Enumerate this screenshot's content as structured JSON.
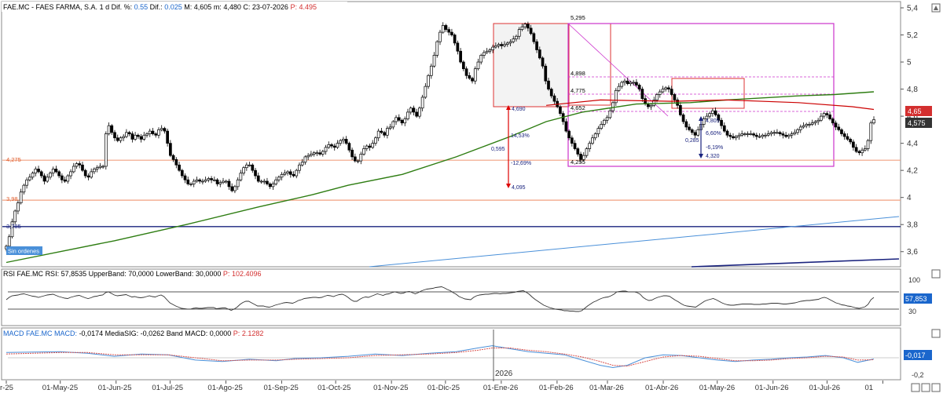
{
  "header": {
    "ticker": "FAE.MC",
    "company": "FAES FARMA, S.A.",
    "period": "1 d",
    "dif_pct_label": "Dif. %:",
    "dif_pct": "0.55",
    "dif_label": "Dif.:",
    "dif": "0.025",
    "max_label": "M:",
    "max": "4,605",
    "min_label": "m:",
    "min": "4,480",
    "cierre_label": "C:",
    "date": "23-07-2026",
    "price_label": "P:",
    "price": "4.495"
  },
  "rsi_header": {
    "name": "RSI",
    "ticker": "FAE.MC",
    "rsi_label": "RSI:",
    "rsi": "57,8535",
    "upper_label": "UpperBand:",
    "upper": "70,0000",
    "lower_label": "LowerBand:",
    "lower": "30,0000",
    "p_label": "P:",
    "p": "102.4096"
  },
  "macd_header": {
    "name": "MACD",
    "ticker": "FAE.MC",
    "macd_label": "MACD:",
    "macd": "-0,0174",
    "signal_label": "MediaSIG:",
    "signal": "-0,0262",
    "band_label": "Band MACD:",
    "band": "0,0000",
    "p_label": "P:",
    "p": "2.1282"
  },
  "order_badge": "Sin ordenes",
  "year_marker": "2026",
  "colors": {
    "up": "#ffffff",
    "down": "#000000",
    "sma_long": "#2e7d12",
    "sma_short": "#cc0000",
    "horiz_orange": "#f0a080",
    "horiz_blue": "#1a237e",
    "trend_blue": "#4a90d9",
    "magenta": "#cc33cc",
    "box_fill": "#f3f3f3",
    "price_badge": "#d32f2f",
    "last_badge": "#333333",
    "macd_line": "#4a90d9",
    "macd_signal": "#d9534f"
  },
  "chart_data": [
    {
      "type": "candlestick",
      "title": "",
      "x_ticks": [
        "r-25",
        "01-May-25",
        "01-Jun-25",
        "01-Jul-25",
        "01-Ago-25",
        "01-Sep-25",
        "01-Oct-25",
        "01-Nov-25",
        "01-Dic-25",
        "01-Ene-26",
        "01-Feb-26",
        "01-Mar-26",
        "01-Abr-26",
        "01-May-26",
        "01-Jun-26",
        "01-Jul-26",
        "01"
      ],
      "y_ticks": [
        "5,4",
        "5,2",
        "5",
        "4,8",
        "4,6",
        "4,4",
        "4,2",
        "4",
        "3,8",
        "3,6"
      ],
      "ylim": [
        3.5,
        5.4
      ],
      "xlim_days": [
        0,
        482
      ],
      "x_tick_days": [
        0,
        30,
        61,
        91,
        122,
        153,
        183,
        214,
        244,
        275,
        306,
        334,
        365,
        395,
        426,
        456,
        487
      ],
      "close": [
        3.64,
        3.71,
        3.82,
        3.9,
        3.96,
        4.04,
        4.09,
        4.13,
        4.15,
        4.18,
        4.21,
        4.19,
        4.16,
        4.12,
        4.15,
        4.18,
        4.21,
        4.19,
        4.16,
        4.13,
        4.12,
        4.16,
        4.19,
        4.23,
        4.25,
        4.24,
        4.2,
        4.16,
        4.15,
        4.19,
        4.21,
        4.22,
        4.23,
        4.23,
        4.47,
        4.53,
        4.48,
        4.44,
        4.42,
        4.44,
        4.45,
        4.48,
        4.47,
        4.43,
        4.46,
        4.45,
        4.43,
        4.46,
        4.47,
        4.49,
        4.47,
        4.46,
        4.5,
        4.51,
        4.49,
        4.4,
        4.31,
        4.28,
        4.24,
        4.2,
        4.16,
        4.13,
        4.1,
        4.1,
        4.12,
        4.13,
        4.12,
        4.12,
        4.13,
        4.14,
        4.13,
        4.13,
        4.1,
        4.11,
        4.12,
        4.12,
        4.08,
        4.05,
        4.08,
        4.13,
        4.18,
        4.22,
        4.24,
        4.24,
        4.2,
        4.16,
        4.12,
        4.12,
        4.12,
        4.1,
        4.08,
        4.1,
        4.13,
        4.15,
        4.17,
        4.18,
        4.19,
        4.17,
        4.16,
        4.2,
        4.24,
        4.26,
        4.3,
        4.31,
        4.32,
        4.33,
        4.33,
        4.32,
        4.34,
        4.37,
        4.39,
        4.38,
        4.37,
        4.4,
        4.42,
        4.43,
        4.4,
        4.35,
        4.3,
        4.27,
        4.27,
        4.32,
        4.36,
        4.38,
        4.37,
        4.4,
        4.44,
        4.49,
        4.48,
        4.46,
        4.51,
        4.52,
        4.56,
        4.59,
        4.57,
        4.55,
        4.58,
        4.63,
        4.66,
        4.63,
        4.6,
        4.66,
        4.74,
        4.82,
        4.9,
        4.97,
        5.05,
        5.15,
        5.22,
        5.27,
        5.24,
        5.22,
        5.2,
        5.14,
        5.08,
        5.0,
        4.95,
        4.9,
        4.88,
        4.86,
        4.95,
        5.0,
        5.05,
        5.07,
        5.08,
        5.09,
        5.11,
        5.12,
        5.13,
        5.12,
        5.13,
        5.14,
        5.15,
        5.17,
        5.19,
        5.24,
        5.26,
        5.28,
        5.25,
        5.21,
        5.15,
        5.09,
        5.03,
        4.97,
        4.86,
        4.8,
        4.75,
        4.71,
        4.67,
        4.62,
        4.56,
        4.49,
        4.44,
        4.4,
        4.36,
        4.32,
        4.28,
        4.31,
        4.36,
        4.4,
        4.44,
        4.47,
        4.51,
        4.54,
        4.57,
        4.59,
        4.64,
        4.7,
        4.79,
        4.82,
        4.85,
        4.86,
        4.84,
        4.85,
        4.85,
        4.83,
        4.8,
        4.73,
        4.69,
        4.67,
        4.68,
        4.72,
        4.76,
        4.78,
        4.8,
        4.81,
        4.8,
        4.76,
        4.72,
        4.68,
        4.61,
        4.56,
        4.52,
        4.5,
        4.48,
        4.46,
        4.5,
        4.54,
        4.58,
        4.6,
        4.62,
        4.64,
        4.61,
        4.57,
        4.53,
        4.49,
        4.46,
        4.45,
        4.44,
        4.45,
        4.46,
        4.47,
        4.47,
        4.47,
        4.47,
        4.46,
        4.45,
        4.45,
        4.46,
        4.46,
        4.47,
        4.48,
        4.48,
        4.48,
        4.47,
        4.46,
        4.45,
        4.46,
        4.47,
        4.48,
        4.5,
        4.52,
        4.53,
        4.54,
        4.54,
        4.55,
        4.56,
        4.57,
        4.6,
        4.62,
        4.61,
        4.58,
        4.55,
        4.52,
        4.5,
        4.47,
        4.45,
        4.43,
        4.41,
        4.37,
        4.34,
        4.33,
        4.35,
        4.36,
        4.42,
        4.55,
        4.575
      ],
      "hlines": [
        4.275,
        3.98,
        3.785
      ],
      "annotations": [
        "5,295",
        "4,898",
        "4,775",
        "4,652",
        "4,255",
        "4,690",
        "4,095",
        "14,53%",
        "0,595",
        "-12,69%",
        "4,805",
        "6,60%",
        "0,285",
        "-6,19%",
        "4,320",
        "4,275",
        "3,98",
        "3,785"
      ],
      "sma_long": [
        [
          0,
          3.52
        ],
        [
          60,
          3.68
        ],
        [
          100,
          3.8
        ],
        [
          140,
          3.93
        ],
        [
          170,
          4.02
        ],
        [
          190,
          4.09
        ],
        [
          220,
          4.17
        ],
        [
          250,
          4.3
        ],
        [
          280,
          4.45
        ],
        [
          300,
          4.56
        ],
        [
          320,
          4.63
        ],
        [
          350,
          4.69
        ],
        [
          380,
          4.7
        ],
        [
          400,
          4.72
        ],
        [
          440,
          4.75
        ],
        [
          460,
          4.76
        ],
        [
          482,
          4.78
        ]
      ],
      "sma_short": [
        [
          300,
          4.68
        ],
        [
          330,
          4.72
        ],
        [
          370,
          4.71
        ],
        [
          400,
          4.72
        ],
        [
          440,
          4.7
        ],
        [
          470,
          4.67
        ],
        [
          482,
          4.65
        ]
      ],
      "price_badge": "4,65",
      "last_badge": "4,575"
    },
    {
      "type": "line",
      "title": "",
      "name": "RSI",
      "ylim": [
        0,
        100
      ],
      "y_ticks": [
        "100",
        "30"
      ],
      "upper_band": 70,
      "lower_band": 30,
      "last_badge": "57,853",
      "values": [
        52,
        58,
        62,
        63,
        64,
        66,
        67,
        65,
        63,
        61,
        60,
        58,
        60,
        62,
        64,
        65,
        66,
        63,
        60,
        58,
        56,
        55,
        58,
        60,
        62,
        63,
        60,
        57,
        55,
        57,
        60,
        61,
        63,
        64,
        70,
        72,
        68,
        64,
        62,
        63,
        64,
        65,
        62,
        59,
        60,
        58,
        57,
        58,
        60,
        62,
        60,
        59,
        62,
        64,
        60,
        52,
        44,
        40,
        36,
        33,
        30,
        29,
        28,
        28,
        30,
        31,
        30,
        30,
        31,
        32,
        32,
        32,
        29,
        30,
        31,
        31,
        28,
        25,
        28,
        33,
        40,
        45,
        48,
        48,
        44,
        40,
        36,
        36,
        36,
        34,
        33,
        35,
        38,
        40,
        42,
        44,
        45,
        44,
        43,
        46,
        50,
        52,
        55,
        56,
        57,
        58,
        58,
        57,
        58,
        61,
        63,
        62,
        60,
        63,
        65,
        66,
        63,
        58,
        52,
        48,
        48,
        53,
        57,
        59,
        58,
        61,
        64,
        67,
        65,
        63,
        66,
        67,
        70,
        72,
        70,
        68,
        69,
        72,
        73,
        70,
        67,
        70,
        74,
        77,
        79,
        80,
        81,
        83,
        84,
        85,
        82,
        78,
        75,
        70,
        66,
        60,
        57,
        54,
        53,
        52,
        58,
        62,
        64,
        65,
        66,
        66,
        67,
        68,
        68,
        67,
        68,
        68,
        69,
        70,
        71,
        73,
        74,
        75,
        71,
        66,
        59,
        53,
        48,
        43,
        38,
        35,
        32,
        30,
        28,
        27,
        26,
        24,
        24,
        23,
        23,
        22,
        22,
        24,
        30,
        36,
        41,
        46,
        49,
        53,
        56,
        58,
        59,
        62,
        66,
        72,
        73,
        74,
        74,
        72,
        72,
        72,
        70,
        66,
        58,
        53,
        50,
        51,
        55,
        58,
        60,
        62,
        62,
        61,
        56,
        51,
        47,
        42,
        38,
        36,
        35,
        34,
        33,
        38,
        43,
        48,
        51,
        53,
        55,
        52,
        48,
        44,
        41,
        39,
        38,
        38,
        39,
        40,
        41,
        41,
        41,
        41,
        40,
        40,
        40,
        41,
        41,
        42,
        43,
        43,
        43,
        42,
        41,
        41,
        42,
        43,
        44,
        46,
        48,
        49,
        50,
        50,
        51,
        52,
        53,
        56,
        58,
        56,
        52,
        48,
        44,
        42,
        39,
        38,
        36,
        35,
        33,
        31,
        30,
        32,
        34,
        40,
        52,
        57.85
      ]
    },
    {
      "type": "line",
      "title": "",
      "name": "MACD",
      "ylim": [
        -0.25,
        0.25
      ],
      "y_ticks": [
        "-0,2"
      ],
      "last_badge": "-0,017",
      "macd": [
        [
          0,
          0.07
        ],
        [
          30,
          0.08
        ],
        [
          45,
          0.06
        ],
        [
          60,
          0.02
        ],
        [
          75,
          0.05
        ],
        [
          90,
          0.04
        ],
        [
          105,
          -0.03
        ],
        [
          120,
          -0.05
        ],
        [
          135,
          -0.02
        ],
        [
          150,
          -0.04
        ],
        [
          160,
          -0.01
        ],
        [
          175,
          0.0
        ],
        [
          190,
          0.02
        ],
        [
          205,
          0.05
        ],
        [
          220,
          0.03
        ],
        [
          235,
          0.06
        ],
        [
          250,
          0.08
        ],
        [
          262,
          0.13
        ],
        [
          270,
          0.16
        ],
        [
          280,
          0.12
        ],
        [
          290,
          0.08
        ],
        [
          300,
          0.06
        ],
        [
          310,
          0.04
        ],
        [
          320,
          -0.03
        ],
        [
          330,
          -0.1
        ],
        [
          337,
          -0.13
        ],
        [
          345,
          -0.1
        ],
        [
          355,
          0.0
        ],
        [
          365,
          0.04
        ],
        [
          375,
          0.03
        ],
        [
          385,
          0.0
        ],
        [
          395,
          -0.03
        ],
        [
          405,
          -0.05
        ],
        [
          415,
          -0.03
        ],
        [
          425,
          -0.02
        ],
        [
          435,
          0.0
        ],
        [
          445,
          0.01
        ],
        [
          455,
          0.03
        ],
        [
          465,
          0.0
        ],
        [
          473,
          -0.06
        ],
        [
          482,
          -0.017
        ]
      ],
      "signal": [
        [
          0,
          0.05
        ],
        [
          30,
          0.07
        ],
        [
          45,
          0.07
        ],
        [
          60,
          0.04
        ],
        [
          75,
          0.04
        ],
        [
          90,
          0.04
        ],
        [
          105,
          0.0
        ],
        [
          120,
          -0.04
        ],
        [
          135,
          -0.03
        ],
        [
          150,
          -0.03
        ],
        [
          160,
          -0.02
        ],
        [
          175,
          -0.01
        ],
        [
          190,
          0.0
        ],
        [
          205,
          0.03
        ],
        [
          220,
          0.04
        ],
        [
          235,
          0.05
        ],
        [
          250,
          0.07
        ],
        [
          262,
          0.1
        ],
        [
          270,
          0.13
        ],
        [
          280,
          0.13
        ],
        [
          290,
          0.1
        ],
        [
          300,
          0.08
        ],
        [
          310,
          0.05
        ],
        [
          320,
          0.01
        ],
        [
          330,
          -0.05
        ],
        [
          337,
          -0.1
        ],
        [
          345,
          -0.11
        ],
        [
          355,
          -0.05
        ],
        [
          365,
          0.01
        ],
        [
          375,
          0.03
        ],
        [
          385,
          0.02
        ],
        [
          395,
          -0.01
        ],
        [
          405,
          -0.04
        ],
        [
          415,
          -0.04
        ],
        [
          425,
          -0.03
        ],
        [
          435,
          -0.01
        ],
        [
          445,
          0.0
        ],
        [
          455,
          0.02
        ],
        [
          465,
          0.01
        ],
        [
          473,
          -0.03
        ],
        [
          482,
          -0.026
        ]
      ]
    }
  ]
}
